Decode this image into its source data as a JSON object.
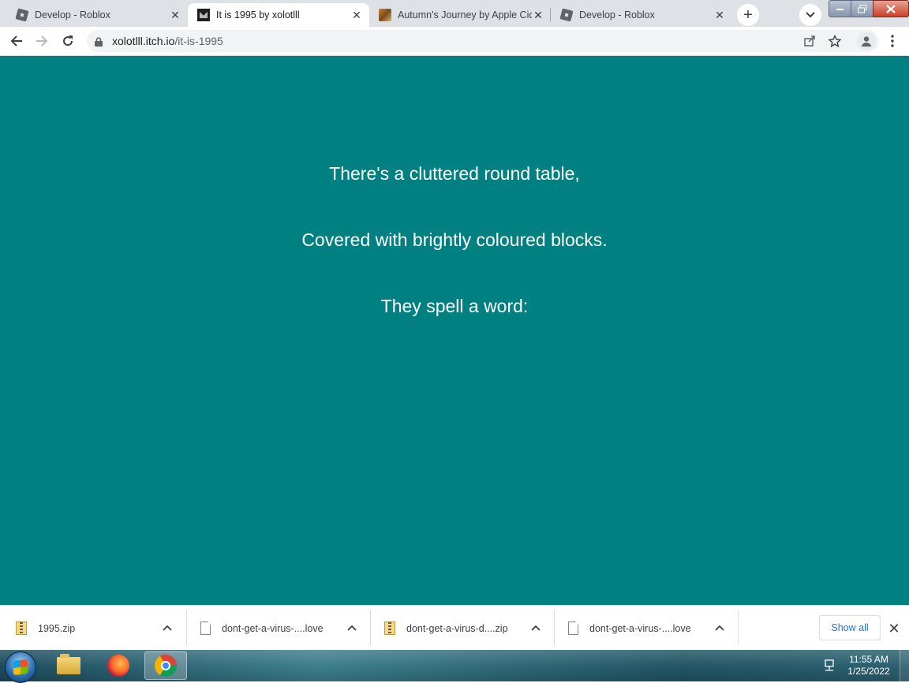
{
  "browser": {
    "tabs": [
      {
        "title": "Develop - Roblox",
        "icon": "roblox-favicon",
        "active": false
      },
      {
        "title": "It is 1995 by xolotlll",
        "icon": "itch-favicon",
        "active": true
      },
      {
        "title": "Autumn's Journey by Apple Cic",
        "icon": "autumn-favicon",
        "active": false
      },
      {
        "title": "Develop - Roblox",
        "icon": "roblox-favicon",
        "active": false
      }
    ],
    "tab_close_glyph": "✕",
    "new_tab_glyph": "+",
    "address": {
      "host": "xolotlll.itch.io",
      "path": "/it-is-1995"
    }
  },
  "page": {
    "background": "#008080",
    "lines": [
      "There's a cluttered round table,",
      "Covered with brightly coloured blocks.",
      "They spell a word:"
    ]
  },
  "downloads": {
    "items": [
      {
        "name": "1995.zip",
        "icon": "zip-file-icon"
      },
      {
        "name": "dont-get-a-virus-....love",
        "icon": "file-icon"
      },
      {
        "name": "dont-get-a-virus-d....zip",
        "icon": "zip-file-icon"
      },
      {
        "name": "dont-get-a-virus-....love",
        "icon": "file-icon"
      }
    ],
    "show_all_label": "Show all",
    "close_glyph": "✕"
  },
  "taskbar": {
    "time": "11:55 AM",
    "date": "1/25/2022"
  }
}
